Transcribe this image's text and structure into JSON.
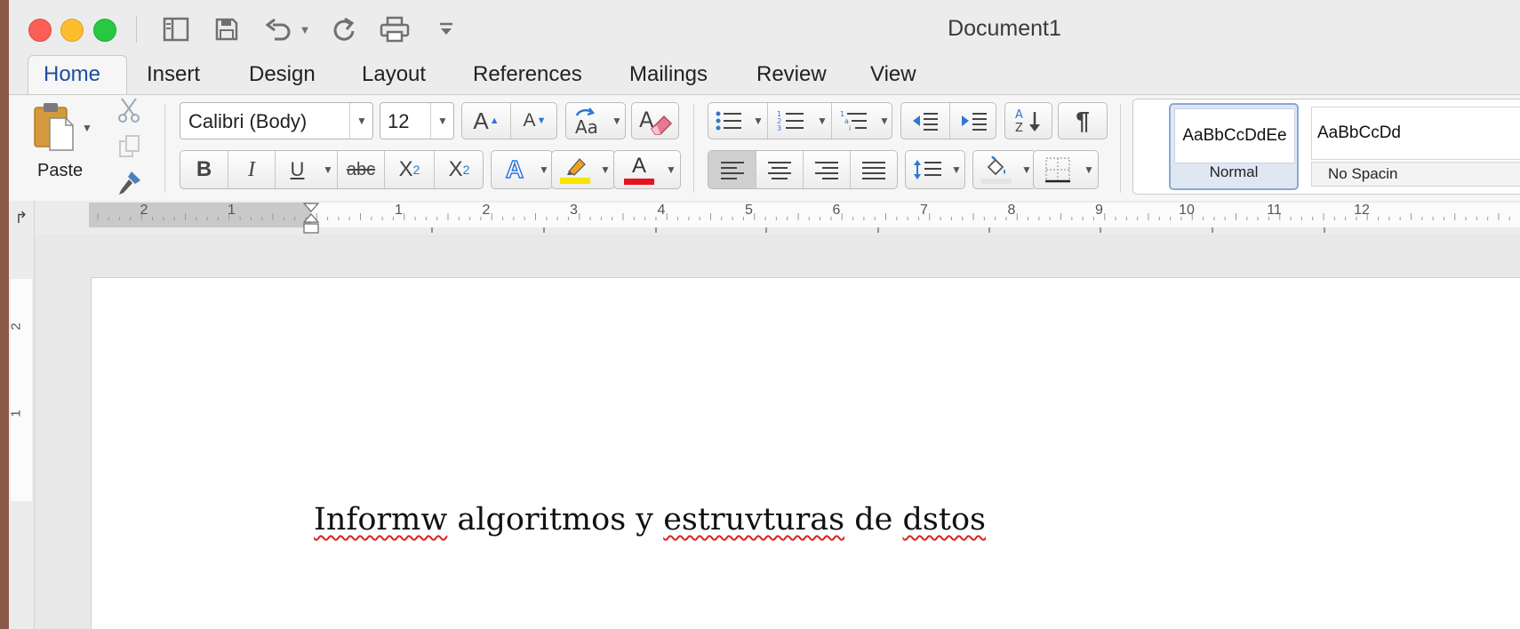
{
  "window": {
    "title": "Document1"
  },
  "quick_access": [
    "sidebar-icon",
    "save-icon",
    "undo-icon",
    "redo-icon",
    "print-icon",
    "customize-icon"
  ],
  "tabs": [
    {
      "label": "Home",
      "active": true
    },
    {
      "label": "Insert"
    },
    {
      "label": "Design"
    },
    {
      "label": "Layout"
    },
    {
      "label": "References"
    },
    {
      "label": "Mailings"
    },
    {
      "label": "Review"
    },
    {
      "label": "View"
    }
  ],
  "clipboard": {
    "paste_label": "Paste"
  },
  "font": {
    "family": "Calibri (Body)",
    "size": "12"
  },
  "styles": [
    {
      "preview": "AaBbCcDdEe",
      "name": "Normal",
      "selected": true
    },
    {
      "preview": "AaBbCcDd",
      "name": "No Spacin"
    }
  ],
  "ruler": {
    "left_numbers": [
      "2",
      "1"
    ],
    "right_numbers": [
      "1",
      "2",
      "3",
      "4",
      "5",
      "6",
      "7",
      "8",
      "9",
      "10",
      "11",
      "12"
    ],
    "vertical_numbers": [
      "2",
      "1"
    ]
  },
  "document": {
    "words": [
      {
        "text": "Informw",
        "misspelled": true
      },
      {
        "text": " algoritmos y ",
        "misspelled": false
      },
      {
        "text": "estruvturas",
        "misspelled": true
      },
      {
        "text": " de ",
        "misspelled": false
      },
      {
        "text": "dstos",
        "misspelled": true
      }
    ]
  },
  "colors": {
    "highlight": "#f5e600",
    "font_color": "#e8121f",
    "active_tab": "#1f4da0",
    "accent_blue": "#2b78d6"
  }
}
